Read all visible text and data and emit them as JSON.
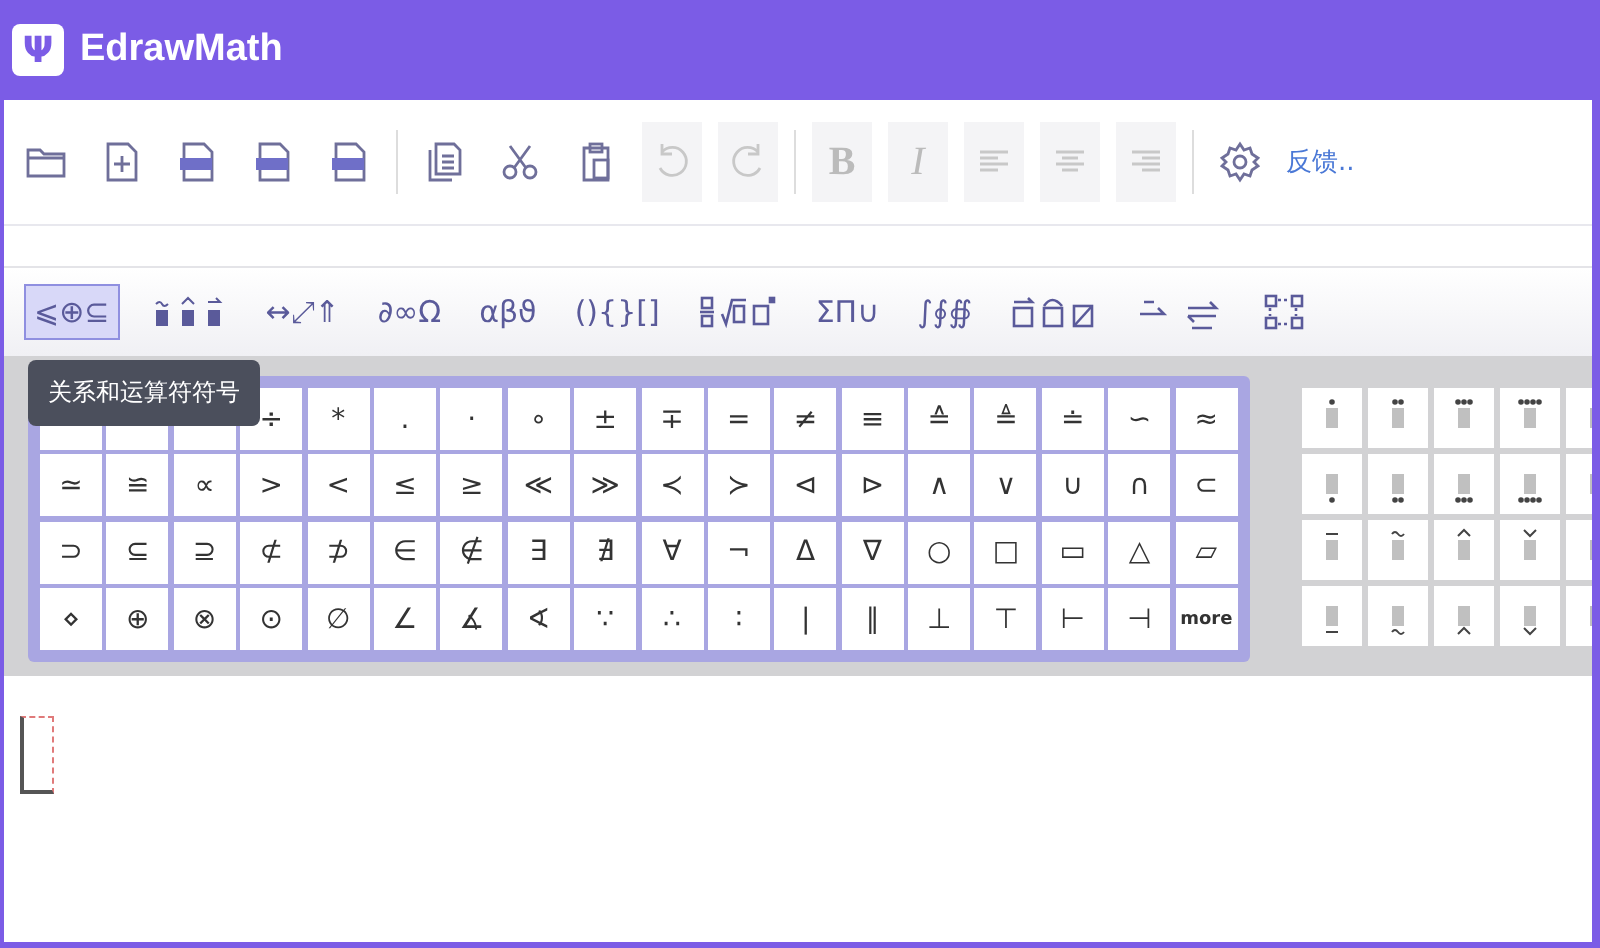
{
  "app": {
    "logo": "Ψ",
    "title": "EdrawMath"
  },
  "toolbar": [
    {
      "kind": "folder",
      "disabled": false
    },
    {
      "kind": "new-file",
      "disabled": false
    },
    {
      "kind": "export-file",
      "disabled": false
    },
    {
      "kind": "export-file",
      "disabled": false
    },
    {
      "kind": "export-file",
      "disabled": false
    },
    {
      "kind": "separator"
    },
    {
      "kind": "copy",
      "disabled": false
    },
    {
      "kind": "cut",
      "disabled": false
    },
    {
      "kind": "paste",
      "disabled": false
    },
    {
      "kind": "undo",
      "disabled": true
    },
    {
      "kind": "redo",
      "disabled": true
    },
    {
      "kind": "separator"
    },
    {
      "kind": "text",
      "label": "B",
      "disabled": true
    },
    {
      "kind": "text",
      "label": "I",
      "disabled": true
    },
    {
      "kind": "align-left",
      "disabled": true
    },
    {
      "kind": "align-center",
      "disabled": true
    },
    {
      "kind": "align-right",
      "disabled": true
    },
    {
      "kind": "separator"
    },
    {
      "kind": "settings",
      "disabled": false
    }
  ],
  "feedback_link": "反馈..",
  "category_tabs": [
    {
      "kind": "text",
      "label": "⩽⊕⊆",
      "selected": true
    },
    {
      "kind": "accents",
      "selected": false
    },
    {
      "kind": "text",
      "label": "↔⤢⇑",
      "selected": false
    },
    {
      "kind": "text",
      "label": "∂∞Ω",
      "selected": false
    },
    {
      "kind": "text",
      "label": "αβϑ",
      "selected": false
    },
    {
      "kind": "text",
      "label": "(){}[]",
      "selected": false
    },
    {
      "kind": "fraction",
      "selected": false
    },
    {
      "kind": "text",
      "label": "ΣΠ∪",
      "selected": false
    },
    {
      "kind": "text",
      "label": "∫∮∯",
      "selected": false
    },
    {
      "kind": "boxes",
      "selected": false
    },
    {
      "kind": "arrows",
      "selected": false
    },
    {
      "kind": "matrix",
      "selected": false
    }
  ],
  "tooltip": "关系和运算符符号",
  "symbols": [
    [
      "÷",
      "*",
      ".",
      "·",
      "∘",
      "±",
      "∓",
      "=",
      "≠",
      "≡",
      "≙",
      "≜",
      "≐",
      "∽",
      "≈"
    ],
    [
      "≃",
      "≌",
      "∝",
      ">",
      "<",
      "≤",
      "≥",
      "≪",
      "≫",
      "≺",
      "≻",
      "⊲",
      "⊳",
      "∧",
      "∨",
      "∪",
      "∩",
      "⊂"
    ],
    [
      "⊃",
      "⊆",
      "⊇",
      "⊄",
      "⊅",
      "∈",
      "∉",
      "∃",
      "∄",
      "∀",
      "¬",
      "Δ",
      "∇",
      "○",
      "□",
      "▭",
      "△",
      "▱"
    ],
    [
      "⋄",
      "⊕",
      "⊗",
      "⊙",
      "∅",
      "∠",
      "∡",
      "∢",
      "∵",
      "∴",
      "∶",
      "|",
      "∥",
      "⊥",
      "⊤",
      "⊢",
      "⊣",
      "more"
    ]
  ]
}
